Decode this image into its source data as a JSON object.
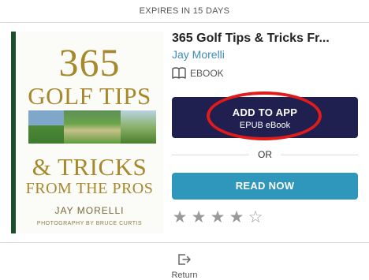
{
  "header": {
    "expires": "EXPIRES IN 15 DAYS"
  },
  "cover": {
    "line1": "365",
    "line2": "GOLF TIPS",
    "line3": "& TRICKS",
    "line4": "FROM THE PROS",
    "author": "JAY MORELLI",
    "photographer": "PHOTOGRAPHY BY BRUCE CURTIS",
    "border_color": "#1b4f2c",
    "text_color": "#a8882d"
  },
  "book": {
    "title": "365 Golf Tips & Tricks Fr...",
    "author": "Jay Morelli",
    "format": "EBOOK",
    "format_icon": "open-book-icon"
  },
  "actions": {
    "add_label": "ADD TO APP",
    "add_sub": "EPUB eBook",
    "or_label": "OR",
    "read_label": "READ NOW",
    "add_color": "#1f2050",
    "read_color": "#2f97bc",
    "highlight_color": "#e01b1b"
  },
  "rating": {
    "value": 4,
    "max": 5,
    "full_glyph": "★",
    "empty_glyph": "☆"
  },
  "footer": {
    "return_label": "Return",
    "return_icon": "return-icon"
  }
}
